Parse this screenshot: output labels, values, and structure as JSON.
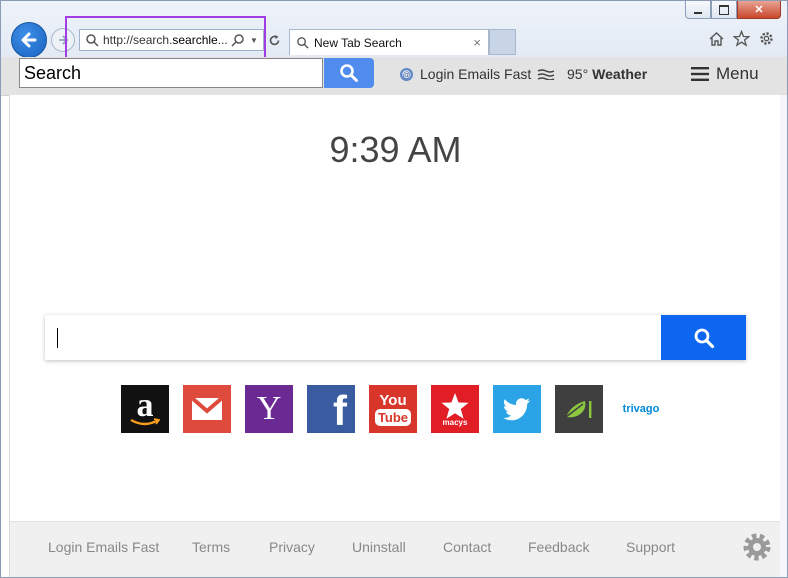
{
  "browser": {
    "address_url_prefix": "http://search.",
    "address_url_bold": "searchle",
    "address_url_suffix": "...",
    "tab_title": "New Tab Search",
    "tab_close": "×"
  },
  "toolbar": {
    "search_placeholder": "Search",
    "login_label": "Login Emails Fast",
    "temperature": "95°",
    "weather_label": "Weather",
    "menu_label": "Menu"
  },
  "main": {
    "time": "9:39 AM",
    "search_value": ""
  },
  "tiles": [
    {
      "name": "amazon",
      "label": "a"
    },
    {
      "name": "gmail",
      "label": ""
    },
    {
      "name": "yahoo",
      "label": "Y"
    },
    {
      "name": "facebook",
      "label": "f"
    },
    {
      "name": "youtube",
      "label_top": "You",
      "label_bottom": "Tube"
    },
    {
      "name": "macys",
      "label": "macys"
    },
    {
      "name": "twitter",
      "label": ""
    },
    {
      "name": "tripadvisor",
      "label": ""
    },
    {
      "name": "trivago",
      "label": "trivago"
    }
  ],
  "footer": {
    "links": [
      "Login Emails Fast",
      "Terms",
      "Privacy",
      "Uninstall",
      "Contact",
      "Feedback",
      "Support"
    ]
  },
  "colors": {
    "search_button": "#0d66f0",
    "toolbar_button": "#4f8cee",
    "highlight": "#a23de3"
  }
}
